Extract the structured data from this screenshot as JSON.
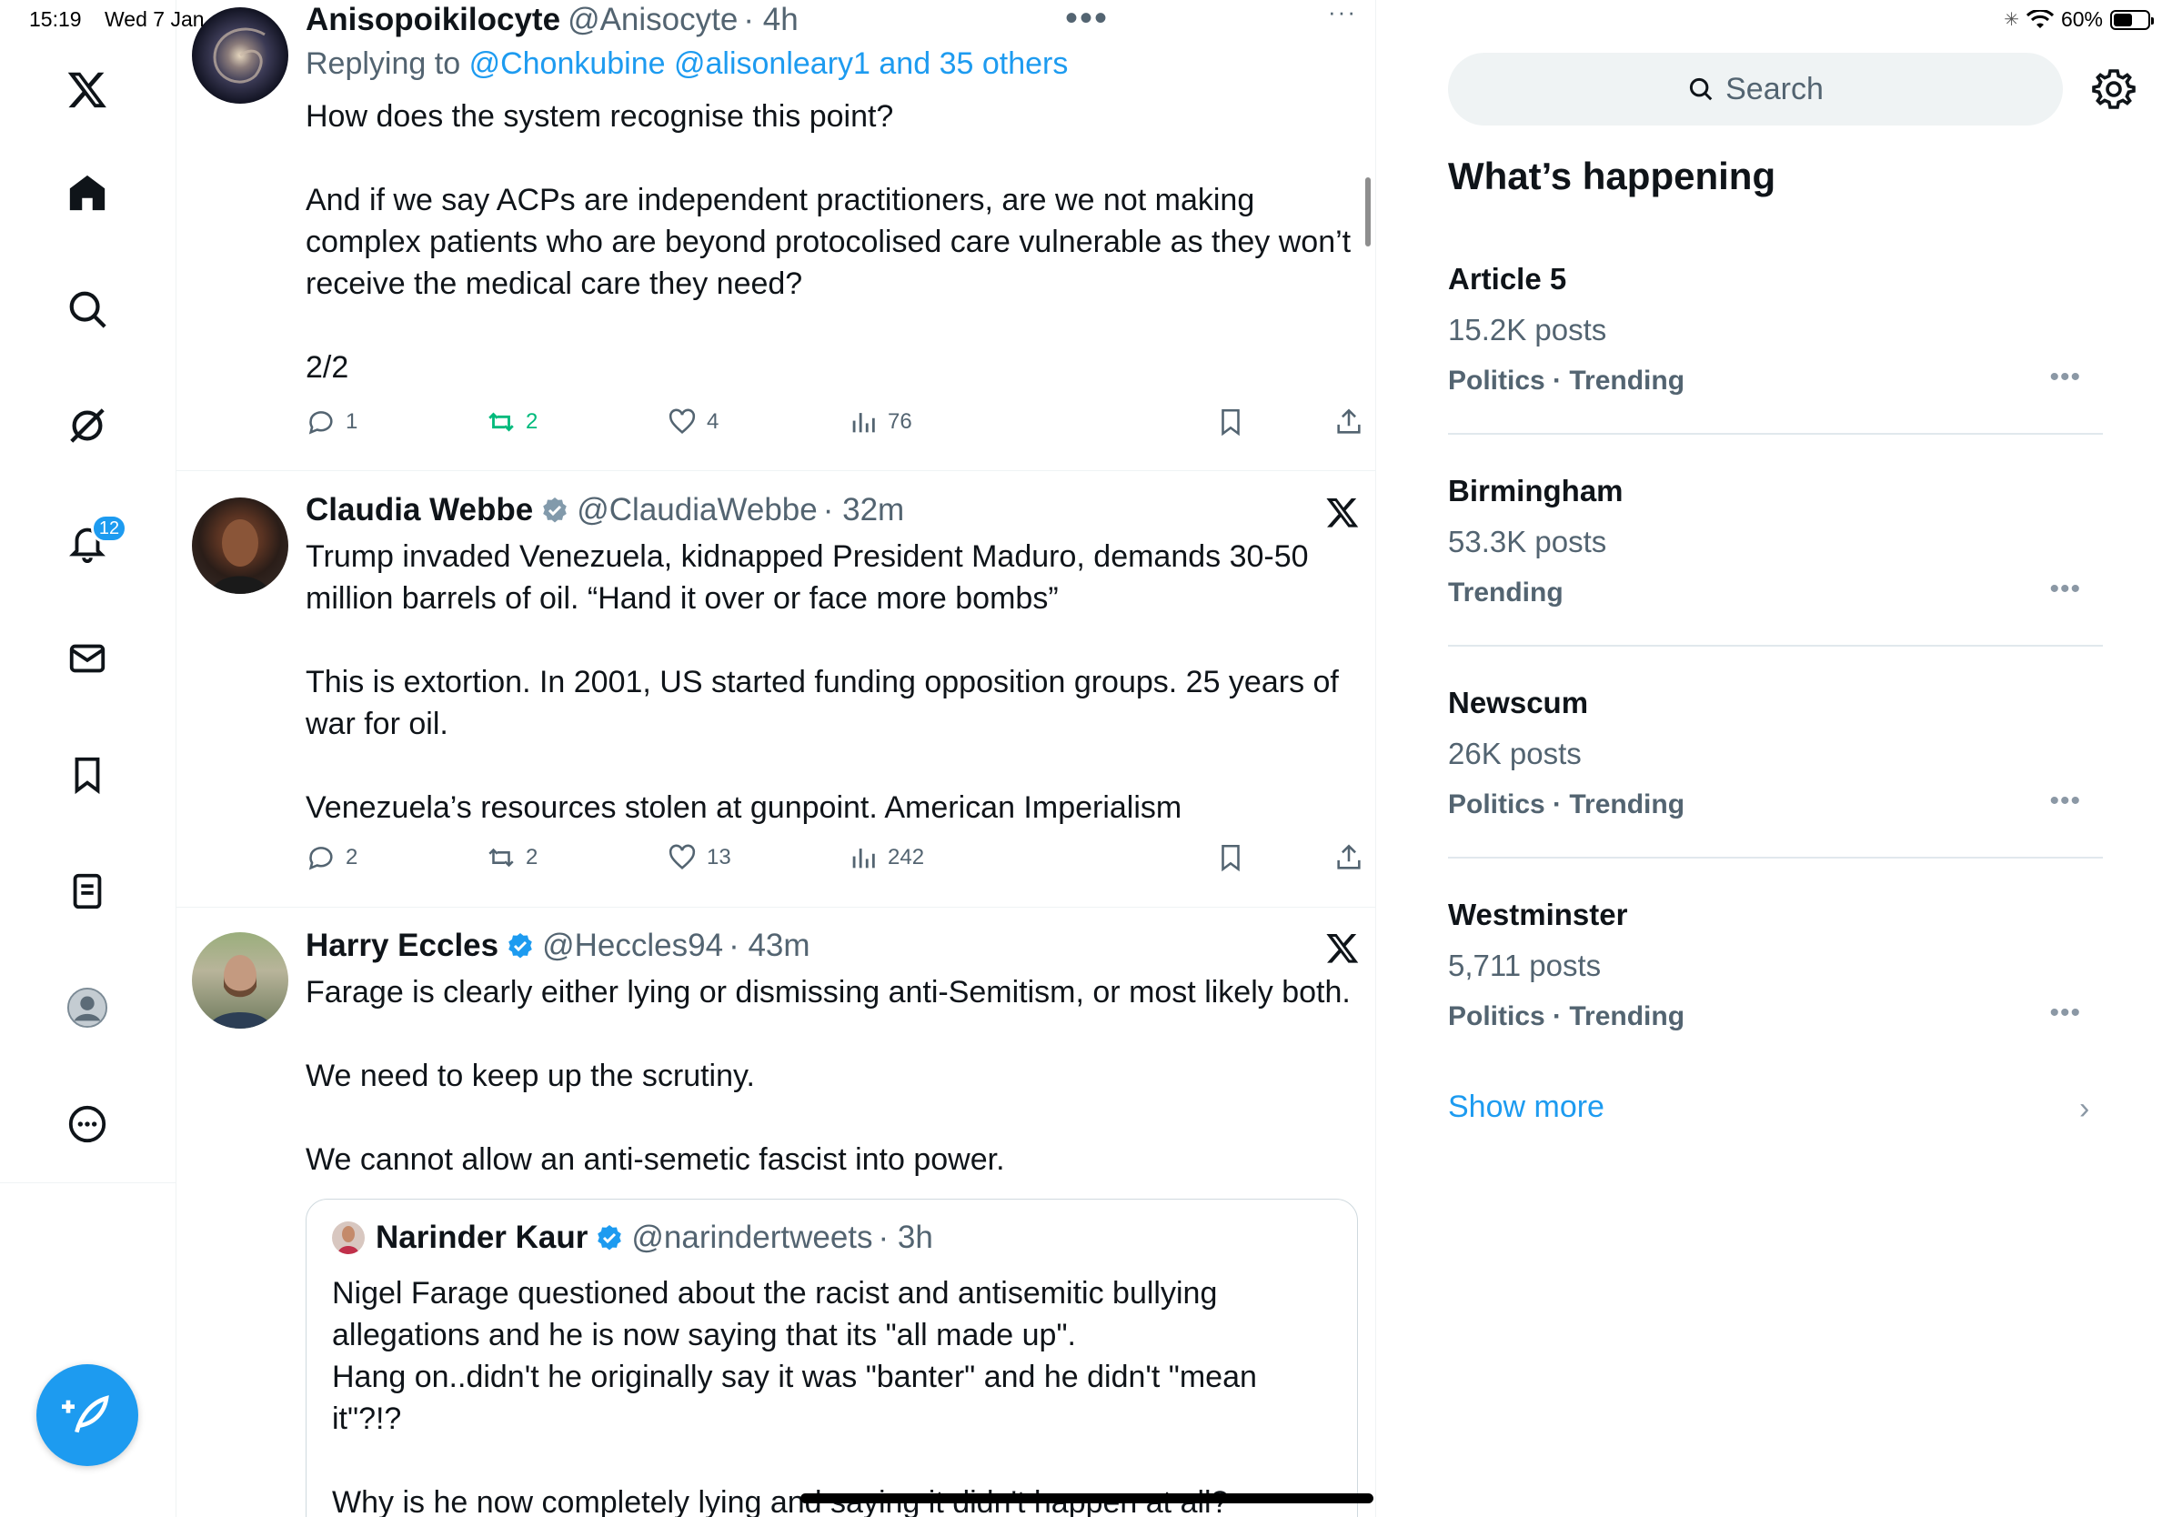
{
  "status_bar": {
    "time": "15:19",
    "date": "Wed 7 Jan",
    "battery": "60%",
    "battery_level": 0.6
  },
  "nav": {
    "notifications_badge": "12"
  },
  "tweets": [
    {
      "name": "Anisopoikilocyte",
      "handle": "@Anisocyte",
      "time": "· 4h",
      "replying_prefix": "Replying to",
      "replying_to": "@Chonkubine @alisonleary1 and 35 others",
      "text": "How does the system recognise this point?\n\nAnd if we say ACPs are independent practitioners, are we not making complex patients who are beyond protocolised care vulnerable as they won’t receive the medical care they need?\n\n2/2",
      "replies": "1",
      "reposts": "2",
      "likes": "4",
      "views": "76"
    },
    {
      "name": "Claudia Webbe",
      "handle": "@ClaudiaWebbe",
      "time": "· 32m",
      "text": "Trump invaded Venezuela, kidnapped President Maduro, demands 30-50 million barrels of oil. “Hand it over or face more bombs”\n\nThis is extortion. In 2001, US started funding opposition groups. 25 years of war for oil.\n\nVenezuela’s resources stolen at gunpoint. American Imperialism",
      "replies": "2",
      "reposts": "2",
      "likes": "13",
      "views": "242"
    },
    {
      "name": "Harry Eccles",
      "handle": "@Heccles94",
      "time": "· 43m",
      "text": "Farage is clearly either lying or dismissing anti-Semitism, or most likely both.\n\nWe need to keep up the scrutiny.\n\nWe cannot allow an anti-semetic fascist into power.",
      "quote": {
        "name": "Narinder Kaur",
        "handle": "@narindertweets",
        "time": "· 3h",
        "text": "Nigel Farage questioned about the racist and antisemitic bullying allegations and he is now saying that its \"all made up\".\nHang on..didn't he originally say it was \"banter\" and he didn't \"mean it\"?!?\n\nWhy is he now completely lying and saying it didn't happen at all?"
      }
    }
  ],
  "search": {
    "placeholder": "Search"
  },
  "whats_happening": {
    "title": "What’s happening",
    "trends": [
      {
        "name": "Article 5",
        "count": "15.2K posts",
        "category": "Politics · Trending"
      },
      {
        "name": "Birmingham",
        "count": "53.3K posts",
        "category": "Trending"
      },
      {
        "name": "Newscum",
        "count": "26K posts",
        "category": "Politics · Trending"
      },
      {
        "name": "Westminster",
        "count": "5,711 posts",
        "category": "Politics · Trending"
      }
    ],
    "show_more": "Show more"
  },
  "colors": {
    "accent": "#1d9bf0",
    "repost_green": "#00ba7c",
    "secondary_text": "#536471"
  }
}
